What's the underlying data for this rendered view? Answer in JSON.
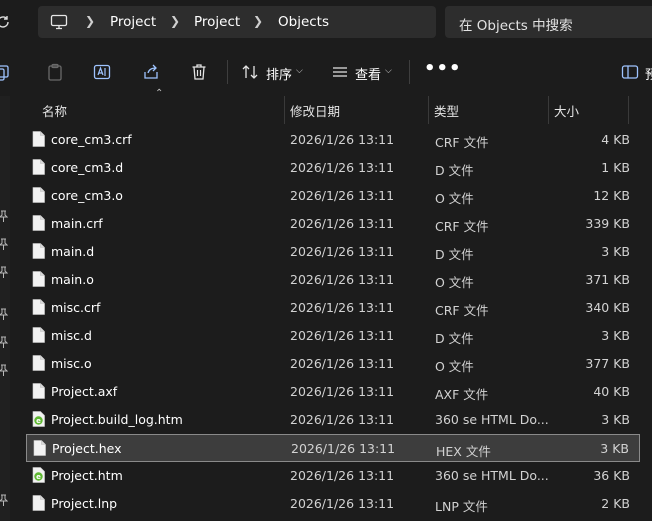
{
  "address": {
    "crumbs": [
      "Project",
      "Project",
      "Objects"
    ],
    "search_placeholder": "在 Objects 中搜索"
  },
  "toolbar": {
    "sort_label": "排序",
    "view_label": "查看",
    "preview_label": "预"
  },
  "columns": {
    "name": "名称",
    "date": "修改日期",
    "type": "类型",
    "size": "大小"
  },
  "files": [
    {
      "name": "core_cm3.crf",
      "date": "2026/1/26 13:11",
      "type": "CRF 文件",
      "size": "4 KB",
      "icon": "file-icon"
    },
    {
      "name": "core_cm3.d",
      "date": "2026/1/26 13:11",
      "type": "D 文件",
      "size": "1 KB",
      "icon": "file-icon"
    },
    {
      "name": "core_cm3.o",
      "date": "2026/1/26 13:11",
      "type": "O 文件",
      "size": "12 KB",
      "icon": "file-icon"
    },
    {
      "name": "main.crf",
      "date": "2026/1/26 13:11",
      "type": "CRF 文件",
      "size": "339 KB",
      "icon": "file-icon"
    },
    {
      "name": "main.d",
      "date": "2026/1/26 13:11",
      "type": "D 文件",
      "size": "3 KB",
      "icon": "file-icon"
    },
    {
      "name": "main.o",
      "date": "2026/1/26 13:11",
      "type": "O 文件",
      "size": "371 KB",
      "icon": "file-icon"
    },
    {
      "name": "misc.crf",
      "date": "2026/1/26 13:11",
      "type": "CRF 文件",
      "size": "340 KB",
      "icon": "file-icon"
    },
    {
      "name": "misc.d",
      "date": "2026/1/26 13:11",
      "type": "D 文件",
      "size": "3 KB",
      "icon": "file-icon"
    },
    {
      "name": "misc.o",
      "date": "2026/1/26 13:11",
      "type": "O 文件",
      "size": "377 KB",
      "icon": "file-icon"
    },
    {
      "name": "Project.axf",
      "date": "2026/1/26 13:11",
      "type": "AXF 文件",
      "size": "40 KB",
      "icon": "file-icon"
    },
    {
      "name": "Project.build_log.htm",
      "date": "2026/1/26 13:11",
      "type": "360 se HTML Do...",
      "size": "3 KB",
      "icon": "html-file-icon"
    },
    {
      "name": "Project.hex",
      "date": "2026/1/26 13:11",
      "type": "HEX 文件",
      "size": "3 KB",
      "icon": "file-icon",
      "selected": true
    },
    {
      "name": "Project.htm",
      "date": "2026/1/26 13:11",
      "type": "360 se HTML Do...",
      "size": "36 KB",
      "icon": "html-file-icon"
    },
    {
      "name": "Project.lnp",
      "date": "2026/1/26 13:11",
      "type": "LNP 文件",
      "size": "2 KB",
      "icon": "file-icon"
    }
  ],
  "colors": {
    "background": "#1c1c1c",
    "control": "#2d2d2d",
    "selection": "#3d3d3d",
    "html_icon_green": "#5fb832"
  }
}
